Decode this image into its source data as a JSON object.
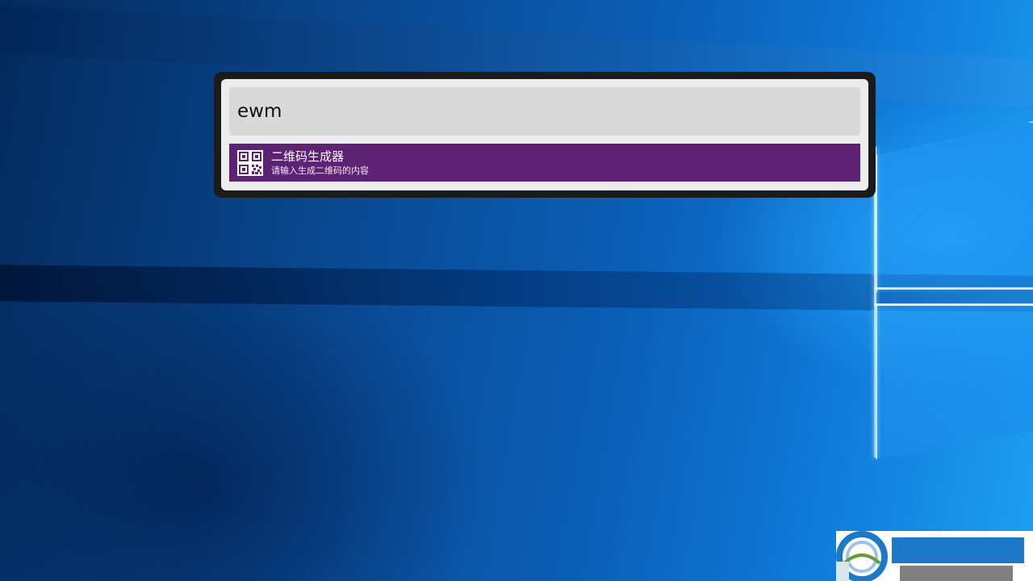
{
  "launcher": {
    "query": "ewm",
    "results": [
      {
        "icon": "qr-code-icon",
        "title": "二维码生成器",
        "subtitle": "请输入生成二维码的内容",
        "selected": true
      }
    ]
  },
  "colors": {
    "launcher_frame": "#1b1b1b",
    "launcher_background": "#ececec",
    "query_background": "#d9d9d9",
    "selected_result": "#5e2275",
    "watermark_blue": "#1e78c8",
    "watermark_gray": "#808080"
  },
  "watermark": {
    "logo": "circular-logo-icon"
  }
}
